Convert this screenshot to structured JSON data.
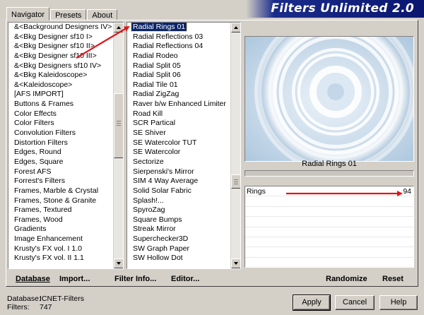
{
  "tabs": [
    "Navigator",
    "Presets",
    "About"
  ],
  "banner": {
    "title": "Filters Unlimited 2.0"
  },
  "categories": [
    "&<Background Designers IV>",
    "&<Bkg Designer sf10 I>",
    "&<Bkg Designer sf10 II>",
    "&<Bkg Designer sf10 III>",
    "&<Bkg Designers sf10 IV>",
    "&<Bkg Kaleidoscope>",
    "&<Kaleidoscope>",
    "[AFS IMPORT]",
    "Buttons & Frames",
    "Color Effects",
    "Color Filters",
    "Convolution Filters",
    "Distortion Filters",
    "Edges, Round",
    "Edges, Square",
    "Forest AFS",
    "Forrest's Filters",
    "Frames, Marble & Crystal",
    "Frames, Stone & Granite",
    "Frames, Textured",
    "Frames, Wood",
    "Gradients",
    "Image Enhancement",
    "Krusty's FX vol. I 1.0",
    "Krusty's FX vol. II 1.1"
  ],
  "filters": [
    "Radial  Rings 01",
    "Radial Reflections 03",
    "Radial Reflections 04",
    "Radial Rodeo",
    "Radial Split 05",
    "Radial Split 06",
    "Radial Tile 01",
    "Radial ZigZag",
    "Raver b/w Enhanced Limiter",
    "Road Kill",
    "SCR  Partical",
    "SE Shiver",
    "SE Watercolor TUT",
    "SE Watercolor",
    "Sectorize",
    "Sierpenski's Mirror",
    "SIM 4 Way Average",
    "Solid Solar Fabric",
    "Splash!...",
    "SpyroZag",
    "Square Bumps",
    "Streak Mirror",
    "Superchecker3D",
    "SW Graph Paper",
    "SW Hollow Dot"
  ],
  "selected_filter": "Radial  Rings 01",
  "parameter": {
    "label": "Rings",
    "value": "94"
  },
  "actions": {
    "database": "Database",
    "import": "Import...",
    "filter_info": "Filter Info...",
    "editor": "Editor...",
    "randomize": "Randomize",
    "reset": "Reset"
  },
  "footer": {
    "database_label": "Database:",
    "database_value": "ICNET-Filters",
    "filters_label": "Filters:",
    "filters_value": "747"
  },
  "buttons": {
    "apply": "Apply",
    "cancel": "Cancel",
    "help": "Help"
  },
  "colors": {
    "selection": "#0a246a",
    "arrow": "#e0161b",
    "banner": "#0a1670"
  }
}
